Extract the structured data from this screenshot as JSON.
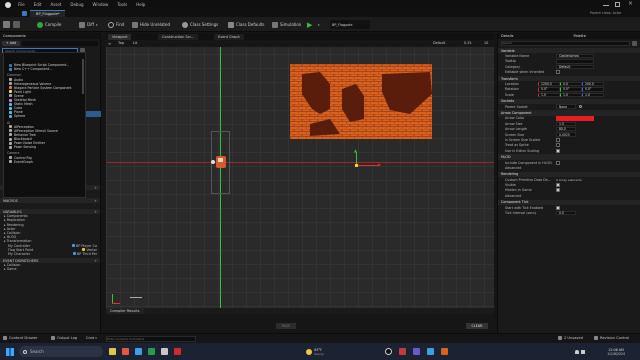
{
  "menu": [
    "File",
    "Edit",
    "Asset",
    "Debug",
    "Window",
    "Tools",
    "Help"
  ],
  "window": {
    "tab": "BP_Flagpole*",
    "parent_class_label": "Parent class: Actor"
  },
  "toolbar": {
    "compile": "Compile",
    "diff": "Diff",
    "find": "Find",
    "hide_unrelated": "Hide Unrelated",
    "class_settings": "Class Settings",
    "class_defaults": "Class Defaults",
    "simulation": "Simulation",
    "play_selector": "BP_Flagpole"
  },
  "components": {
    "tab": "Components",
    "add": "+ Add",
    "search_placeholder": "Search Components",
    "popup_top": [
      "New Blueprint Script Component...",
      "New C++ Component..."
    ],
    "popup_common_header": "Common",
    "popup_items": [
      "Audio",
      "Heterogeneous Volume",
      "Niagara Particle System Component",
      "Point Light",
      "Scene",
      "Skeletal Mesh",
      "Static Mesh",
      "Cube",
      "Plane",
      "Sphere"
    ],
    "popup_ai_header": "AI",
    "popup_ai_items": [
      "AIPerception",
      "AIPerception Stimuli Source",
      "Behavior Tree",
      "Blackboard",
      "Pawn Noise Emitter",
      "Pawn Sensing"
    ],
    "popup_camera_header": "Camera",
    "popup_camera_items": [
      "Control Rig",
      "EventGraph"
    ]
  },
  "my_blueprint": {
    "functions_header": "FUNCTIONS",
    "functions_count": "(1 OVERRIDABLE)",
    "construction_script": "ConstructionScript",
    "macros_header": "MACROS",
    "variables_header": "VARIABLES",
    "variable_categories": [
      "Components",
      "Replication",
      "Rendering",
      "Actor",
      "Collision",
      "HLOD",
      "Transformation"
    ],
    "variables": [
      {
        "name": "My Controller",
        "type": "BP Player Co"
      },
      {
        "name": "Flag Start Point",
        "type": "Vector"
      },
      {
        "name": "My Character",
        "type": "BP Third Per"
      }
    ],
    "dispatchers_header": "EVENT DISPATCHERS",
    "dispatcher_items": [
      "Collision",
      "Game"
    ]
  },
  "viewport": {
    "tabs": [
      "Viewport",
      "Construction Scr...",
      "Event Graph"
    ],
    "perspective": "Top",
    "lit": "Lit",
    "default_label": "Default",
    "speed": "0.25",
    "grid": "10",
    "compiler_tab": "Compiler Results",
    "page_label": "PAGE",
    "clear_label": "CLEAR"
  },
  "details": {
    "tab": "Details",
    "palette_tab": "Palette",
    "search_placeholder": "Search",
    "sections": {
      "variable": "Variable",
      "transform": "Transform",
      "sockets": "Sockets",
      "arrow": "Arrow Component",
      "hlod": "HLOD",
      "advanced": "Advanced",
      "rendering": "Rendering",
      "component_tick": "Component Tick"
    },
    "variable_name": {
      "label": "Variable Name",
      "value": "CastlerArrow"
    },
    "tooltip": {
      "label": "Tooltip",
      "value": ""
    },
    "category": {
      "label": "Category",
      "value": "Default"
    },
    "editable_instanced": "Editable when Inherited",
    "location": {
      "label": "Location",
      "x": "1200.0",
      "y": "0.0",
      "z": "200.0"
    },
    "rotation": {
      "label": "Rotation",
      "x": "0.0°",
      "y": "0.0°",
      "z": "0.0°"
    },
    "scale": {
      "label": "Scale",
      "x": "1.0",
      "y": "1.0",
      "z": "1.0"
    },
    "parent_socket": {
      "label": "Parent Socket",
      "value": "None"
    },
    "arrow_color": {
      "label": "Arrow Color",
      "value": "#e81e1e"
    },
    "arrow_size": {
      "label": "Arrow Size",
      "value": "1.0"
    },
    "arrow_length": {
      "label": "Arrow Length",
      "value": "80.0"
    },
    "screen_size": {
      "label": "Screen Size",
      "value": "0.0025"
    },
    "is_screen_size_scaled": "Is Screen Size Scaled",
    "treat_as_sprite": "Treat as Sprite",
    "use_in_editor_scaling": "Use in Editor Scaling",
    "include_component_hlod": "Include Component in HLOD",
    "custom_primitive_data": {
      "label": "Custom Primitive Data De...",
      "value": "0 Array elements"
    },
    "visible": "Visible",
    "hidden_in_game": "Hidden in Game",
    "start_with_tick": "Start with Tick Enabled",
    "tick_interval": {
      "label": "Tick Interval (secs)",
      "value": "0.0"
    }
  },
  "status": {
    "content_drawer": "Content Drawer",
    "output_log": "Output Log",
    "cmd": "Cmd",
    "console_placeholder": "Enter Console Command",
    "unsaved": "2 Unsaved",
    "revision_control": "Revision Control"
  },
  "taskbar": {
    "search_placeholder": "Search",
    "weather_temp": "63°F",
    "weather_desc": "Sunny",
    "time": "12:06 AM",
    "date": "11/16/2024"
  },
  "colors": {
    "accent": "#3a78c4",
    "brick": "#d9621e",
    "brick_dark": "#7a2a10",
    "arrow_red": "#e81e1e",
    "axis_green": "#33c23c"
  }
}
